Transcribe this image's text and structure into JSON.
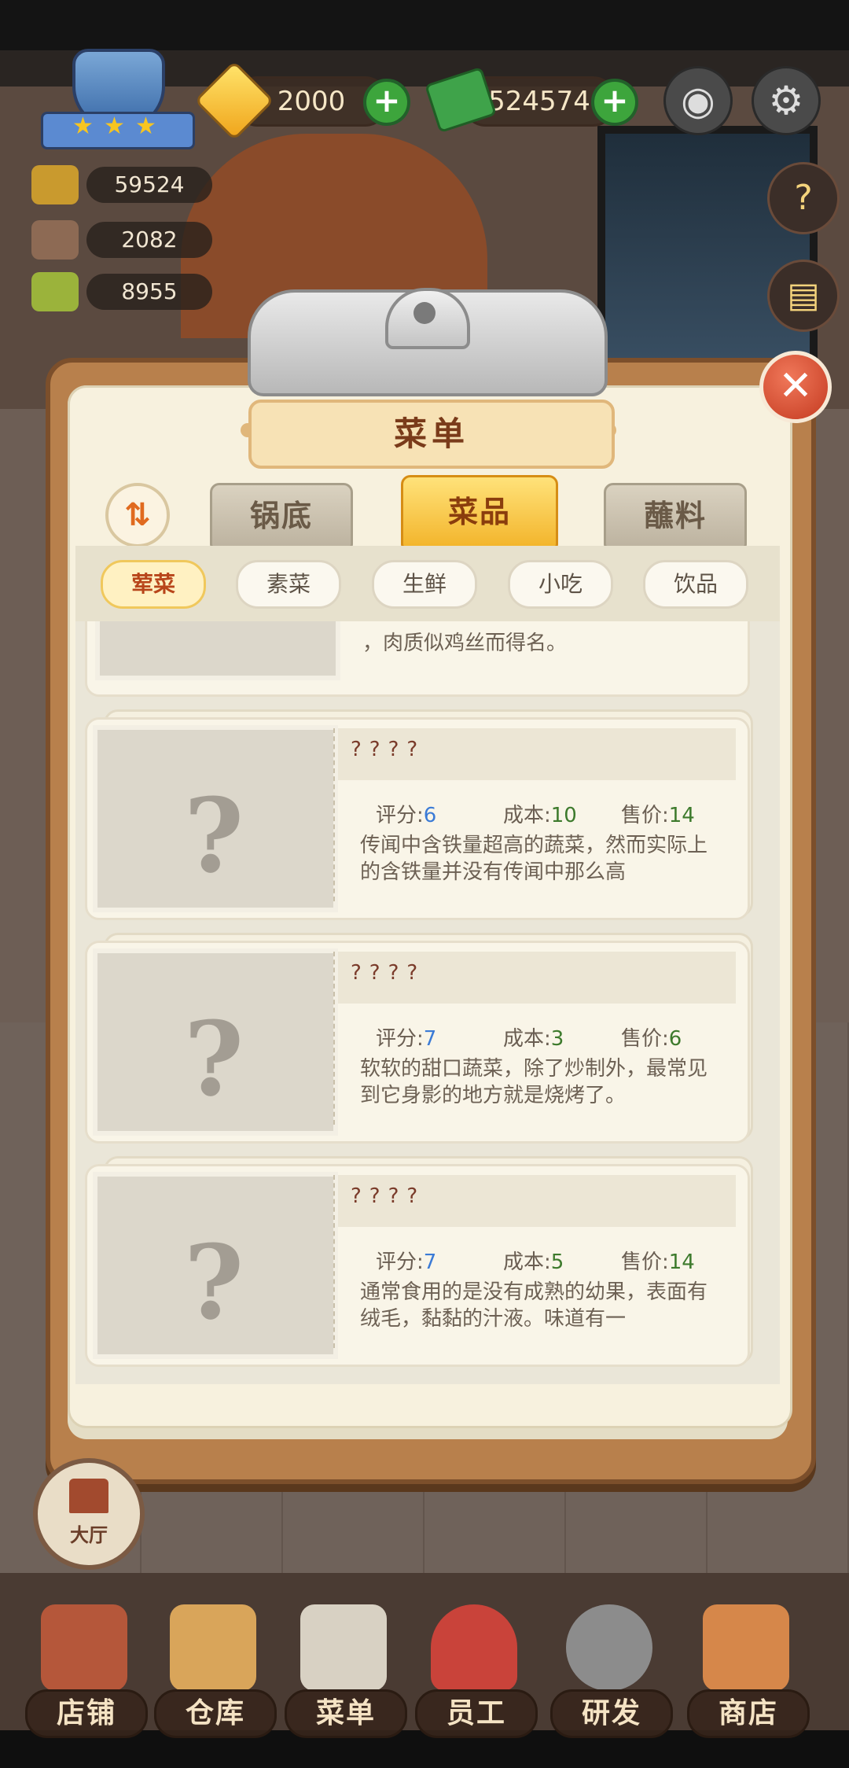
{
  "hud": {
    "gems": "2000",
    "cash": "524574",
    "stats": [
      "59524",
      "2082",
      "8955"
    ]
  },
  "modal": {
    "title": "菜单",
    "sort_icon": "sort-toggle-icon",
    "tabs": [
      "锅底",
      "菜品",
      "蘸料"
    ],
    "active_tab": "菜品",
    "filters": [
      "荤菜",
      "素菜",
      "生鲜",
      "小吃",
      "饮品"
    ],
    "active_filter": "荤菜",
    "partial_card_text": "，肉质似鸡丝而得名。",
    "items": [
      {
        "name": "????",
        "score_label": "评分:",
        "score": "6",
        "cost_label": "成本:",
        "cost": "10",
        "price_label": "售价:",
        "price": "14",
        "desc": "传闻中含铁量超高的蔬菜，然而实际上的含铁量并没有传闻中那么高"
      },
      {
        "name": "????",
        "score_label": "评分:",
        "score": "7",
        "cost_label": "成本:",
        "cost": "3",
        "price_label": "售价:",
        "price": "6",
        "desc": "软软的甜口蔬菜，除了炒制外，最常见到它身影的地方就是烧烤了。"
      },
      {
        "name": "????",
        "score_label": "评分:",
        "score": "7",
        "cost_label": "成本:",
        "cost": "5",
        "price_label": "售价:",
        "price": "14",
        "desc": "通常食用的是没有成熟的幼果，表面有绒毛，黏黏的汁液。味道有一"
      }
    ]
  },
  "hall_button": "大厅",
  "bottom_nav": [
    "店铺",
    "仓库",
    "菜单",
    "员工",
    "研发",
    "商店"
  ],
  "colors": {
    "accent": "#f3b52c",
    "close": "#c43a20",
    "score_blue": "#3b7bd6",
    "price_green": "#3d7a2c"
  }
}
